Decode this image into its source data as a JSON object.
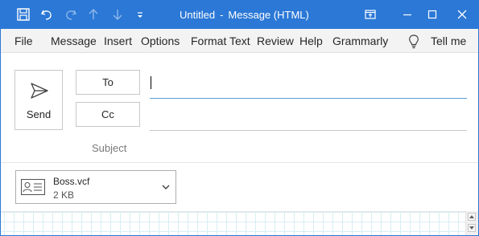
{
  "window": {
    "title": "Untitled",
    "title_separator": "-",
    "title_suffix": "Message (HTML)"
  },
  "quick_access": [
    "save-icon",
    "undo-icon",
    "redo-icon",
    "up-arrow-icon",
    "down-arrow-icon",
    "customize-dropdown-icon"
  ],
  "window_controls": [
    "ribbon-display-options-icon",
    "minimize-icon",
    "maximize-icon",
    "close-icon"
  ],
  "ribbon": {
    "tabs": [
      "File",
      "Message",
      "Insert",
      "Options",
      "Format Text",
      "Review",
      "Help",
      "Grammarly"
    ],
    "tell_me": "Tell me",
    "tell_me_icon": "lightbulb-icon"
  },
  "compose": {
    "send_label": "Send",
    "to_label": "To",
    "cc_label": "Cc",
    "to_value": "",
    "cc_value": "",
    "subject_label": "Subject",
    "subject_value": ""
  },
  "attachment": {
    "name": "Boss.vcf",
    "size": "2 KB",
    "icon": "vcard-icon"
  },
  "colors": {
    "titlebar": "#2b78d6",
    "ribbon_bg": "#f3f3f3",
    "active_field_line": "#5aa0d8",
    "grid_line": "#d7eef2"
  }
}
